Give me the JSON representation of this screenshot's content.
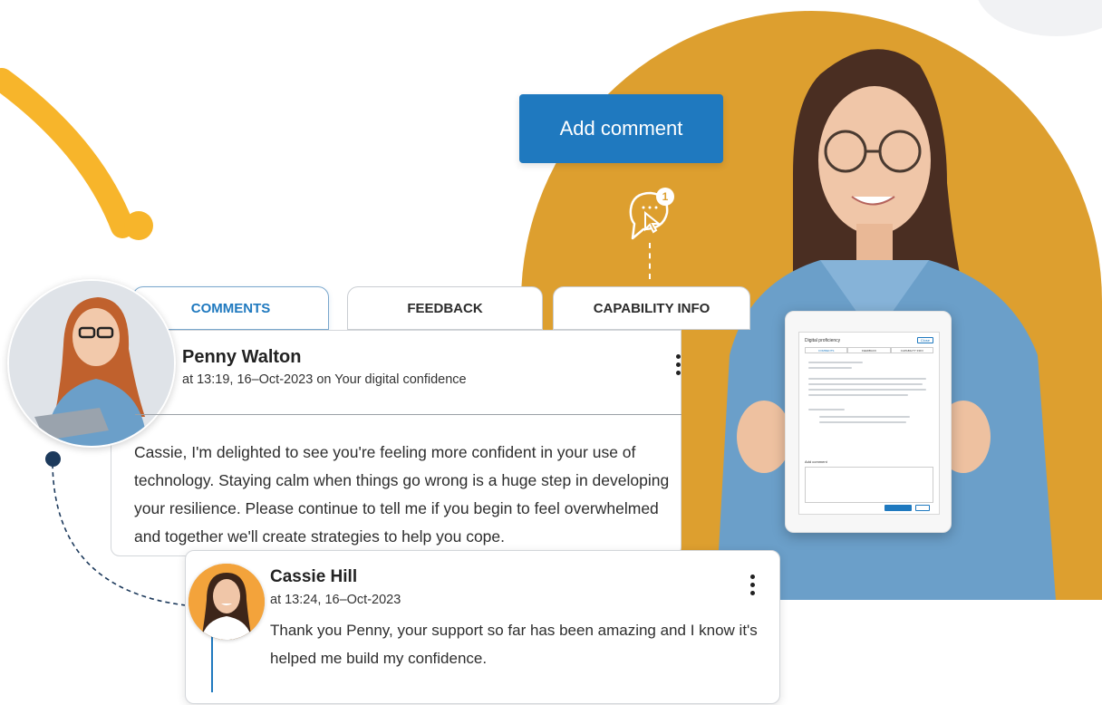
{
  "actions": {
    "add_comment_label": "Add comment",
    "notification_count": "1"
  },
  "tabs": [
    {
      "label": "COMMENTS",
      "active": true
    },
    {
      "label": "FEEDBACK",
      "active": false
    },
    {
      "label": "CAPABILITY INFO",
      "active": false
    }
  ],
  "comment": {
    "author": "Penny Walton",
    "meta": "at 13:19, 16–Oct-2023 on Your digital confidence",
    "body": "Cassie, I'm delighted to see you're feeling more confident in your use of technology. Staying calm when things go wrong is a huge step in developing your resilience. Please continue to tell me if you begin to feel overwhelmed and together we'll create strategies to help you cope."
  },
  "reply": {
    "author": "Cassie Hill",
    "meta": "at 13:24, 16–Oct-2023",
    "body": "Thank you Penny, your support so far has been amazing and I know it's helped me build my confidence."
  },
  "tablet": {
    "title": "Digital proficiency",
    "close_label": "Close",
    "tabs": [
      "COMMENTS",
      "FEEDBACK",
      "CAPABILITY INFO"
    ],
    "add_comment_label": "Add comment"
  },
  "icons": {
    "more_options": "kebab-vertical-icon",
    "comment_cursor": "comment-click-icon"
  },
  "colors": {
    "accent_blue": "#1f79bf",
    "brand_orange": "#dd9f2f",
    "deco_yellow": "#f7b52b",
    "thread_navy": "#1d3a5c"
  }
}
